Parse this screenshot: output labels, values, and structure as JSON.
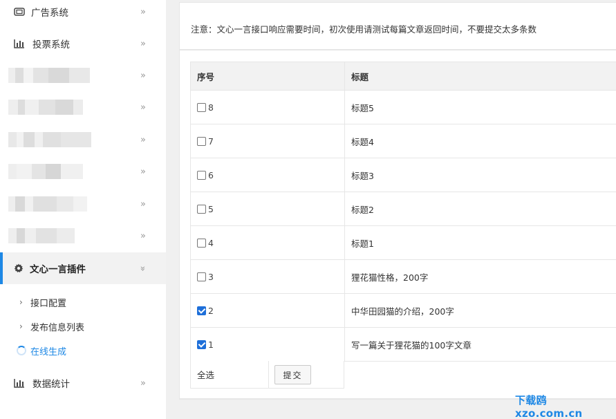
{
  "sidebar": {
    "items": [
      {
        "label": "广告系统",
        "icon": "ad-icon",
        "chevron": "»"
      },
      {
        "label": "投票系统",
        "icon": "bar-chart-icon",
        "chevron": "»"
      },
      {
        "label": "",
        "chevron": "»"
      },
      {
        "label": "",
        "chevron": "»"
      },
      {
        "label": "",
        "chevron": "»"
      },
      {
        "label": "",
        "chevron": "»"
      },
      {
        "label": "",
        "chevron": "»"
      },
      {
        "label": "",
        "chevron": "»"
      },
      {
        "label": "文心一言插件",
        "icon": "gear-icon",
        "chevron": "»"
      }
    ],
    "subitems": [
      {
        "label": "接口配置",
        "chevron": "›"
      },
      {
        "label": "发布信息列表",
        "chevron": "›"
      },
      {
        "label": "在线生成"
      }
    ],
    "bottom": {
      "label": "数据统计",
      "icon": "bar-chart-icon",
      "chevron": "»"
    }
  },
  "notice": "注意：文心一言接口响应需要时间，初次使用请测试每篇文章返回时间，不要提交太多条数",
  "table": {
    "headers": [
      "序号",
      "标题"
    ],
    "rows": [
      {
        "id": "8",
        "title": "标题5",
        "checked": false
      },
      {
        "id": "7",
        "title": "标题4",
        "checked": false
      },
      {
        "id": "6",
        "title": "标题3",
        "checked": false
      },
      {
        "id": "5",
        "title": "标题2",
        "checked": false
      },
      {
        "id": "4",
        "title": "标题1",
        "checked": false
      },
      {
        "id": "3",
        "title": "狸花猫性格，200字",
        "checked": false
      },
      {
        "id": "2",
        "title": "中华田园猫的介绍，200字",
        "checked": true
      },
      {
        "id": "1",
        "title": "写一篇关于狸花猫的100字文章",
        "checked": true
      }
    ],
    "select_all": "全选",
    "submit": "提交"
  },
  "watermark": "下载鸥 xzo.com.cn",
  "colors": {
    "accent": "#1e88e5",
    "checkbox": "#1e6fd9"
  }
}
